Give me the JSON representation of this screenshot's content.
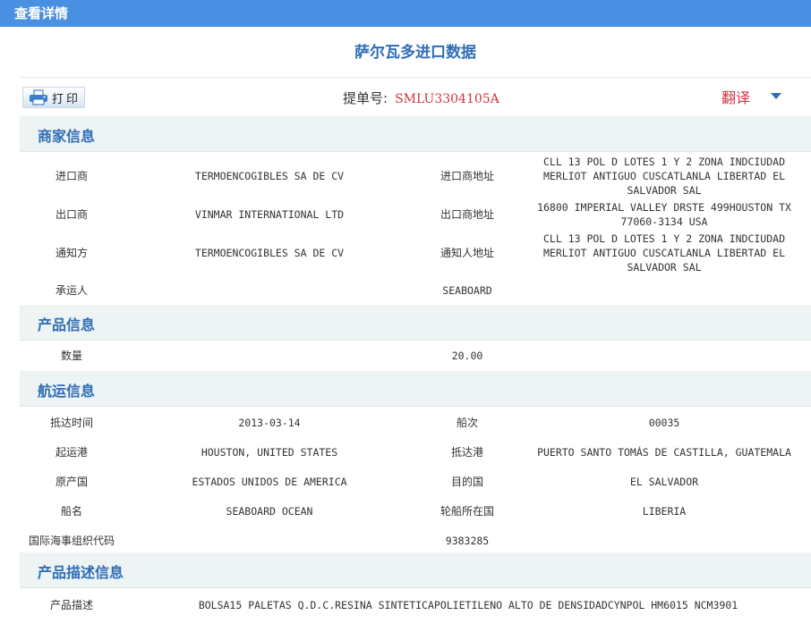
{
  "header": {
    "title": "查看详情"
  },
  "page_title": "萨尔瓦多进口数据",
  "toolbar": {
    "print_label": "打印",
    "bill_label": "提单号:",
    "bill_value": "SMLU3304105A",
    "translate_label": "翻译"
  },
  "sections": {
    "merchant": {
      "title": "商家信息",
      "rows": [
        {
          "label1": "进口商",
          "value1": "TERMOENCOGIBLES SA DE CV",
          "label2": "进口商地址",
          "value2": "CLL 13 POL D LOTES 1 Y 2 ZONA INDCIUDAD MERLIOT ANTIGUO CUSCATLANLA LIBERTAD EL SALVADOR SAL"
        },
        {
          "label1": "出口商",
          "value1": "VINMAR INTERNATIONAL LTD",
          "label2": "出口商地址",
          "value2": "16800 IMPERIAL VALLEY DRSTE 499HOUSTON TX 77060-3134 USA"
        },
        {
          "label1": "通知方",
          "value1": "TERMOENCOGIBLES SA DE CV",
          "label2": "通知人地址",
          "value2": "CLL 13 POL D LOTES 1 Y 2 ZONA INDCIUDAD MERLIOT ANTIGUO CUSCATLANLA LIBERTAD EL SALVADOR SAL"
        },
        {
          "label1": "承运人",
          "value1": "",
          "label2": "SEABOARD",
          "value2": ""
        }
      ]
    },
    "product": {
      "title": "产品信息",
      "rows": [
        {
          "label1": "数量",
          "value1": "",
          "label2": "20.00",
          "value2": ""
        }
      ]
    },
    "shipping": {
      "title": "航运信息",
      "rows": [
        {
          "label1": "抵达时间",
          "value1": "2013-03-14",
          "label2": "船次",
          "value2": "00035"
        },
        {
          "label1": "起运港",
          "value1": "HOUSTON, UNITED STATES",
          "label2": "抵达港",
          "value2": "PUERTO SANTO TOMÁS DE CASTILLA, GUATEMALA"
        },
        {
          "label1": "原产国",
          "value1": "ESTADOS UNIDOS DE AMERICA",
          "label2": "目的国",
          "value2": "EL SALVADOR"
        },
        {
          "label1": "船名",
          "value1": "SEABOARD OCEAN",
          "label2": "轮船所在国",
          "value2": "LIBERIA"
        },
        {
          "label1": "国际海事组织代码",
          "value1": "",
          "label2": "9383285",
          "value2": ""
        }
      ]
    },
    "description": {
      "title": "产品描述信息",
      "rows": [
        {
          "label1": "产品描述",
          "value1": "BOLSA15 PALETAS Q.D.C.RESINA SINTETICAPOLIETILENO ALTO DE DENSIDADCYNPOL HM6015 NCM3901"
        }
      ]
    }
  },
  "colors": {
    "topbar": "#4a90e2",
    "accent": "#2f6db5",
    "highlight": "#d0333c",
    "section_bg": "#eef3f4"
  },
  "icons": {
    "print": "printer-icon",
    "dropdown": "caret-down-icon"
  }
}
